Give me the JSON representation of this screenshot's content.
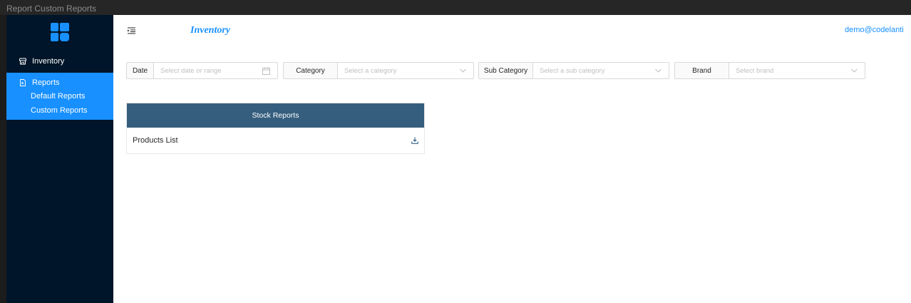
{
  "window": {
    "title": "Report Custom Reports"
  },
  "sidebar": {
    "inventory_label": "Inventory",
    "reports_label": "Reports",
    "default_reports_label": "Default Reports",
    "custom_reports_label": "Custom Reports"
  },
  "header": {
    "title": "Inventory",
    "user_email": "demo@codelanti"
  },
  "filters": {
    "date_label": "Date",
    "date_placeholder": "Select date or range",
    "category_label": "Category",
    "category_placeholder": "Select a category",
    "subcategory_label": "Sub Category",
    "subcategory_placeholder": "Select a sub category",
    "brand_label": "Brand",
    "brand_placeholder": "Select brand"
  },
  "card": {
    "header": "Stock Reports",
    "rows": [
      "Products List"
    ]
  },
  "colors": {
    "sidebar_bg": "#001529",
    "accent": "#1890ff",
    "card_header": "#355e7e"
  }
}
